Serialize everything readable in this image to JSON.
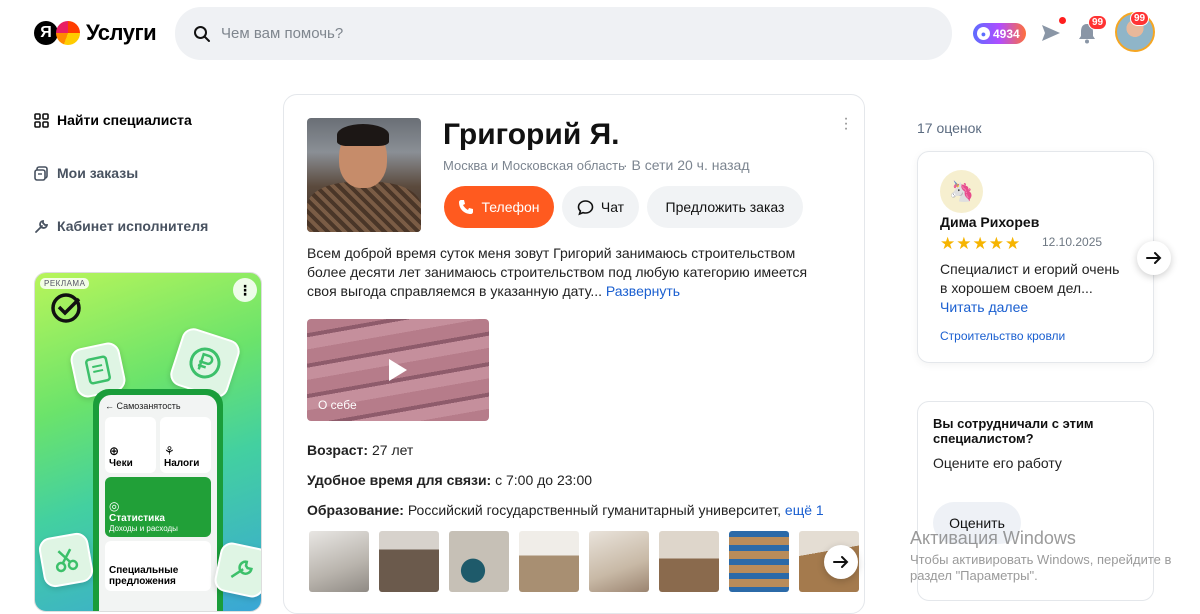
{
  "header": {
    "logo_text": "Услуги",
    "search_placeholder": "Чем вам помочь?",
    "balance": "4934",
    "notifications_badge": "99",
    "avatar_badge": "99"
  },
  "sidebar": {
    "items": [
      {
        "label": "Найти специалиста",
        "icon": "grid-icon"
      },
      {
        "label": "Мои заказы",
        "icon": "orders-icon"
      },
      {
        "label": "Кабинет исполнителя",
        "icon": "wrench-icon"
      }
    ],
    "ad": {
      "label": "РЕКЛАМА",
      "screen_title": "← Самозанятость",
      "tiles": [
        "Чеки",
        "Налоги",
        "Статистика",
        "Доходы и расходы",
        "Специальные предложения"
      ]
    }
  },
  "profile": {
    "name": "Григорий Я.",
    "location": "Москва и Московская область",
    "online": "· В сети 20 ч. назад",
    "buttons": {
      "phone": "Телефон",
      "chat": "Чат",
      "offer": "Предложить заказ"
    },
    "about": "Всем доброй время суток меня зовут Григорий занимаюсь строительством более десяти лет занимаюсь строительством под любую категорию имеется своя выгода справляемся в указанную дату...",
    "expand_link": "Развернуть",
    "video_caption": "О себе",
    "age_label": "Возраст:",
    "age_value": "27 лет",
    "time_label": "Удобное время для связи:",
    "time_value": "с 7:00 до 23:00",
    "edu_label": "Образование:",
    "edu_value": "Российский государственный гуманитарный университет,",
    "edu_more": "ещё 1"
  },
  "reviews": {
    "count": "17 оценок",
    "item": {
      "author": "Дима Рихорев",
      "stars": "★★★★★",
      "date": "12.10.2025",
      "text": "Специалист и егорий очень в хорошем своем дел...",
      "read_more": "Читать далее",
      "tag": "Строительство кровли"
    }
  },
  "cooperation": {
    "question": "Вы сотрудничали с этим специалистом?",
    "subtitle": "Оцените его работу",
    "button": "Оценить"
  },
  "watermark": {
    "line1": "Активация Windows",
    "line2": "Чтобы активировать Windows, перейдите в",
    "line3": "раздел \"Параметры\"."
  },
  "colors": {
    "accent": "#ff5a1f",
    "link": "#1a5fd0",
    "star": "#f6b400"
  }
}
